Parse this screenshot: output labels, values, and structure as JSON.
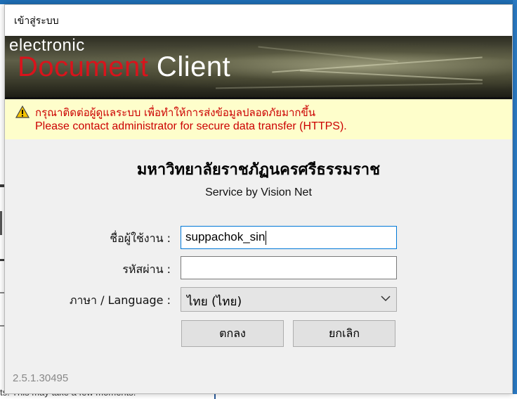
{
  "background": {
    "status_text": "ts. This may take a few moments."
  },
  "dialog": {
    "title": "เข้าสู่ระบบ",
    "banner": {
      "line1": "electronic",
      "line2_red": "Document",
      "line2_white": " Client"
    },
    "warning": {
      "icon": "warning-icon",
      "thai": "กรุณาติดต่อผู้ดูแลระบบ เพื่อทำให้การส่งข้อมูลปลอดภัยมากขึ้น",
      "english": "Please contact administrator for secure data transfer (HTTPS).",
      "color": "#cc0000",
      "background": "#fefecb"
    },
    "organization": "มหาวิทยาลัยราชภัฏนครศรีธรรมราช",
    "service": "Service by Vision Net",
    "form": {
      "username_label": "ชื่อผู้ใช้งาน :",
      "username_value": "suppachok_sin",
      "password_label": "รหัสผ่าน :",
      "password_value": "",
      "language_label": "ภาษา / Language :",
      "language_value": "ไทย (ไทย)"
    },
    "buttons": {
      "ok": "ตกลง",
      "cancel": "ยกเลิก"
    },
    "version": "2.5.1.30495"
  }
}
